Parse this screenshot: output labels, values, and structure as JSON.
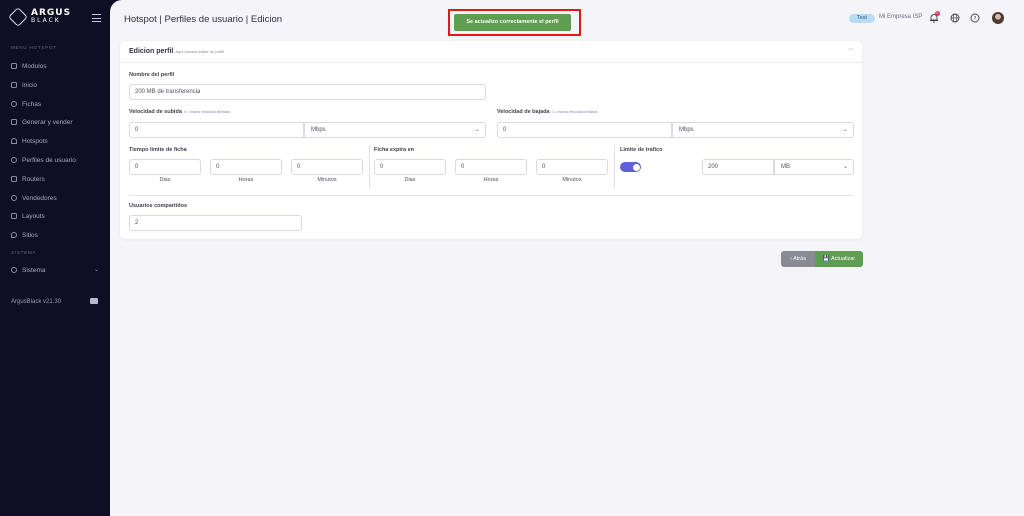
{
  "app": {
    "brand_line1": "ARGUS",
    "brand_line2": "BLACK",
    "version": "ArgusBlack v21.30"
  },
  "sidebar": {
    "section_hotspot": "MENU HOTSPOT",
    "items": [
      {
        "label": "Modulos",
        "icon": "grid-icon"
      },
      {
        "label": "Inicio",
        "icon": "home-icon"
      },
      {
        "label": "Fichas",
        "icon": "ticket-icon"
      },
      {
        "label": "Generar y vender",
        "icon": "grid-icon"
      },
      {
        "label": "Hotspots",
        "icon": "wifi-icon"
      },
      {
        "label": "Perfiles de usuario",
        "icon": "users-icon"
      },
      {
        "label": "Routers",
        "icon": "router-icon"
      },
      {
        "label": "Vendedores",
        "icon": "users-icon"
      },
      {
        "label": "Layouts",
        "icon": "layout-icon"
      },
      {
        "label": "Sitios",
        "icon": "pin-icon"
      }
    ],
    "section_system": "SISTEMA",
    "system_item": "Sistema"
  },
  "header": {
    "title": "Hotspot | Perfiles de usuario | Edicion",
    "toast": "Se actualizo correctamente el perfil",
    "badge": "Test",
    "company": "Mi Empresa ISP",
    "notifications": "0"
  },
  "card": {
    "title": "Edicion perfil",
    "subtitle": "Aqui puedes editar un perfil",
    "more": "···"
  },
  "form": {
    "name_label": "Nombre del perfil",
    "name_value": "200 MB de transferencia",
    "up_label": "Velocidad de subida",
    "up_hint": "0 = misma velocidad ilimitada",
    "up_value": "0",
    "up_unit": "Mbps",
    "down_label": "Velocidad de bajada",
    "down_hint": "0 = misma velocidad ilimitada",
    "down_value": "0",
    "down_unit": "Mbps",
    "limit_label": "Tiempo limite de ficha",
    "limit_days": "0",
    "limit_hours": "0",
    "limit_minutes": "0",
    "expire_label": "Ficha expira en",
    "expire_days": "0",
    "expire_hours": "0",
    "expire_minutes": "0",
    "days_label": "Dias",
    "hours_label": "Horas",
    "minutes_label": "Minutos",
    "traffic_label": "Limite de trafico",
    "traffic_enabled": true,
    "traffic_value": "200",
    "traffic_unit": "MB",
    "shared_label": "Usuarios compartidos",
    "shared_value": "2"
  },
  "actions": {
    "back": "‹ Atrás",
    "update": "💾 Actualizar"
  }
}
